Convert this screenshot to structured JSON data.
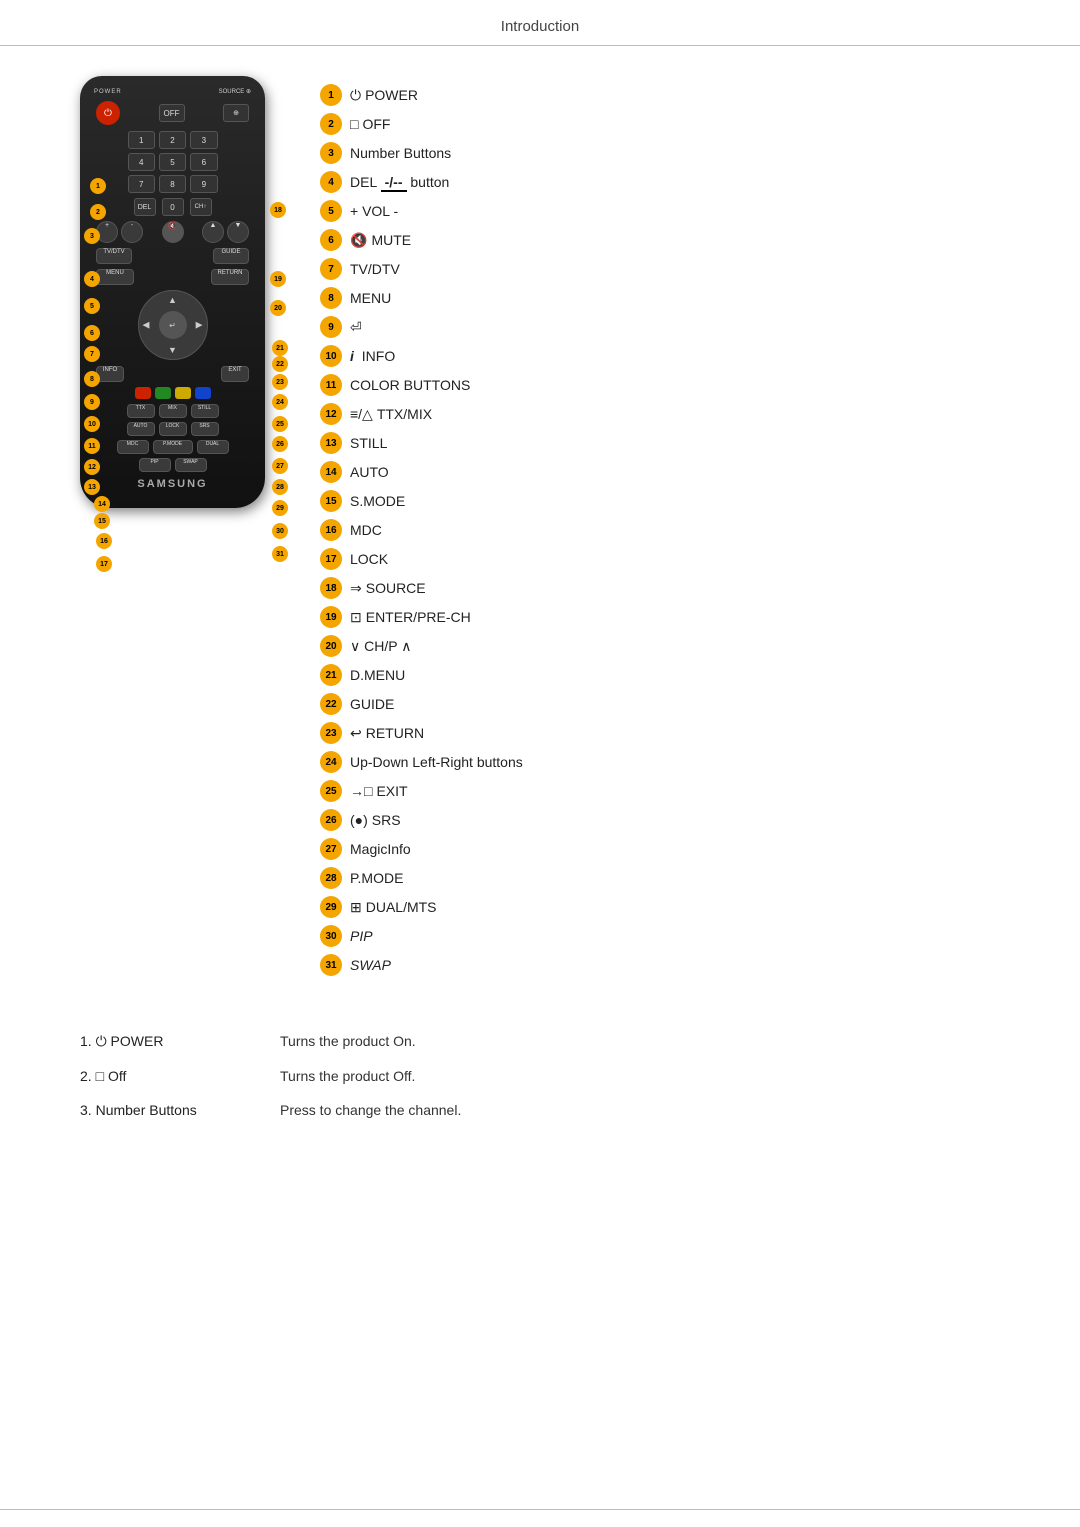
{
  "header": {
    "title": "Introduction"
  },
  "remote": {
    "label": "POWER",
    "brand": "SAMSUNG"
  },
  "legend": [
    {
      "num": "1",
      "icon": "⏻",
      "text": "POWER"
    },
    {
      "num": "2",
      "icon": "□",
      "text": "OFF"
    },
    {
      "num": "3",
      "icon": "",
      "text": "Number Buttons"
    },
    {
      "num": "4",
      "icon": "⁻/⁻⁻",
      "text": "DEL    button"
    },
    {
      "num": "5",
      "icon": "",
      "text": "+ VOL -"
    },
    {
      "num": "6",
      "icon": "🔇",
      "text": "MUTE"
    },
    {
      "num": "7",
      "icon": "",
      "text": "TV/DTV"
    },
    {
      "num": "8",
      "icon": "",
      "text": "MENU"
    },
    {
      "num": "9",
      "icon": "↵",
      "text": ""
    },
    {
      "num": "10",
      "icon": "i",
      "text": "INFO"
    },
    {
      "num": "11",
      "icon": "",
      "text": "COLOR BUTTONS"
    },
    {
      "num": "12",
      "icon": "≡/△",
      "text": "TTX/MIX"
    },
    {
      "num": "13",
      "icon": "",
      "text": "STILL"
    },
    {
      "num": "14",
      "icon": "",
      "text": "AUTO"
    },
    {
      "num": "15",
      "icon": "",
      "text": "S.MODE"
    },
    {
      "num": "16",
      "icon": "",
      "text": "MDC"
    },
    {
      "num": "17",
      "icon": "",
      "text": "LOCK"
    },
    {
      "num": "18",
      "icon": "⇒",
      "text": "SOURCE"
    },
    {
      "num": "19",
      "icon": "⊡",
      "text": "ENTER/PRE-CH"
    },
    {
      "num": "20",
      "icon": "",
      "text": "∨ CH/P ∧"
    },
    {
      "num": "21",
      "icon": "",
      "text": "D.MENU"
    },
    {
      "num": "22",
      "icon": "",
      "text": "GUIDE"
    },
    {
      "num": "23",
      "icon": "↩",
      "text": "RETURN"
    },
    {
      "num": "24",
      "icon": "",
      "text": "Up-Down Left-Right buttons"
    },
    {
      "num": "25",
      "icon": "→□",
      "text": "EXIT"
    },
    {
      "num": "26",
      "icon": "(●)",
      "text": "SRS"
    },
    {
      "num": "27",
      "icon": "",
      "text": "MagicInfo"
    },
    {
      "num": "28",
      "icon": "",
      "text": "P.MODE"
    },
    {
      "num": "29",
      "icon": "⊞",
      "text": "DUAL/MTS"
    },
    {
      "num": "30",
      "icon": "",
      "text": "PIP",
      "italic": true
    },
    {
      "num": "31",
      "icon": "",
      "text": "SWAP",
      "italic": true
    }
  ],
  "descriptions": [
    {
      "num": "1",
      "icon": "⏻",
      "label": "POWER",
      "text": "Turns the product On."
    },
    {
      "num": "2",
      "icon": "□",
      "label": "Off",
      "text": "Turns the product Off."
    },
    {
      "num": "3",
      "label": "Number Buttons",
      "text": "Press to change the channel."
    }
  ]
}
